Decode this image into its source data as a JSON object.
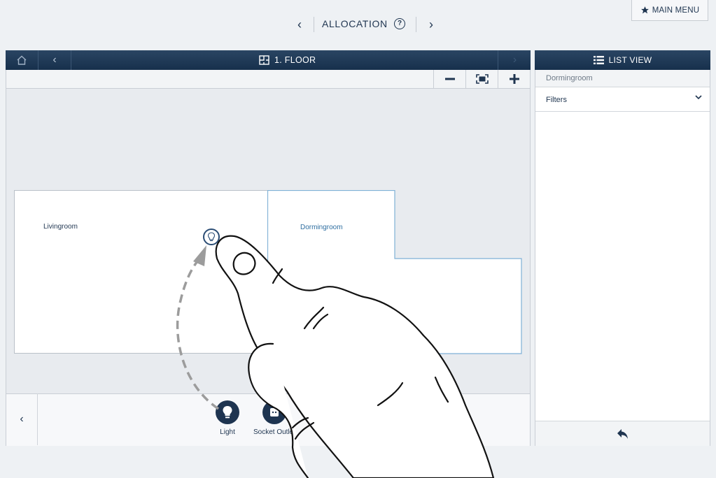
{
  "top_nav": {
    "title": "ALLOCATION",
    "prev_symbol": "‹",
    "next_symbol": "›",
    "help_symbol": "?"
  },
  "main_menu": {
    "label": "MAIN MENU"
  },
  "floor_panel": {
    "title": "1. FLOOR",
    "back_symbol": "‹",
    "forward_symbol": "›"
  },
  "rooms": [
    {
      "label": "Livingroom"
    },
    {
      "label": "Dormingroom"
    }
  ],
  "devices": [
    {
      "label": "Light",
      "icon": "bulb-icon"
    },
    {
      "label": "Socket Outlet",
      "icon": "socket-outlet-icon"
    }
  ],
  "device_bar": {
    "prev_symbol": "‹"
  },
  "list_view": {
    "title": "LIST VIEW",
    "selected_room": "Dormingroom",
    "filters_label": "Filters"
  },
  "colors": {
    "header_dark": "#1c3553",
    "accent_blue": "#2e6ea0",
    "room_border_selected": "#7fb1d6",
    "background": "#eef1f4"
  }
}
